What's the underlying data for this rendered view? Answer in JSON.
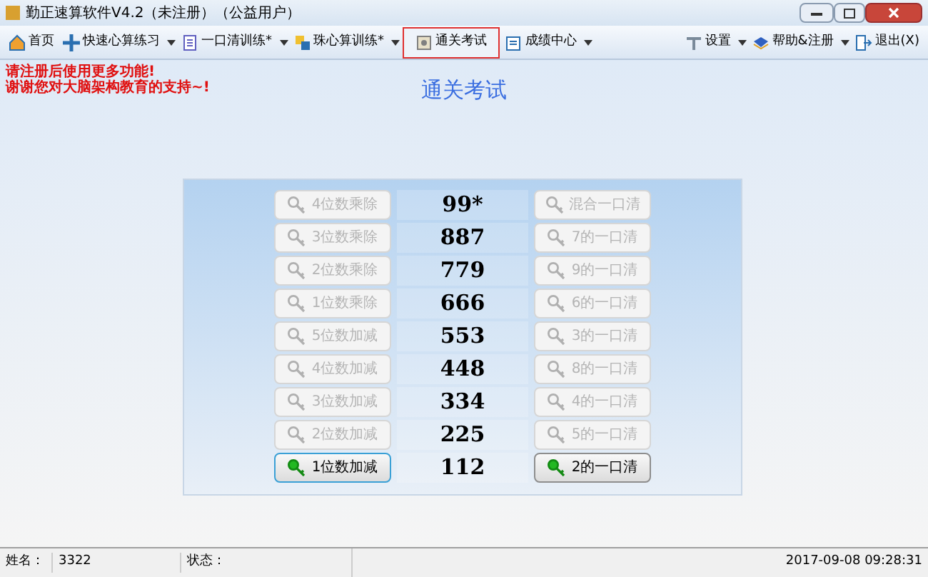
{
  "window": {
    "title": "勤正速算软件V4.2（未注册）（公益用户）"
  },
  "toolbar": {
    "left": [
      {
        "label": "首页",
        "dropdown": false,
        "selected": false
      },
      {
        "label": "快速心算练习",
        "dropdown": true,
        "selected": false
      },
      {
        "label": "一口清训练*",
        "dropdown": true,
        "selected": false
      },
      {
        "label": "珠心算训练*",
        "dropdown": true,
        "selected": false
      },
      {
        "label": "通关考试",
        "dropdown": false,
        "selected": true
      },
      {
        "label": "成绩中心",
        "dropdown": true,
        "selected": false
      }
    ],
    "right": [
      {
        "label": "设置",
        "dropdown": true,
        "selected": false
      },
      {
        "label": "帮助&注册",
        "dropdown": true,
        "selected": false
      },
      {
        "label": "退出(X)",
        "dropdown": false,
        "selected": false
      }
    ]
  },
  "notice": [
    "请注册后使用更多功能!",
    "谢谢您对大脑架构教育的支持~!"
  ],
  "page_title": "通关考试",
  "levels": [
    {
      "left": "4位数乘除",
      "left_disabled": true,
      "number": "99*",
      "right": "混合一口清",
      "right_disabled": true
    },
    {
      "left": "3位数乘除",
      "left_disabled": true,
      "number": "887",
      "right": "7的一口清",
      "right_disabled": true
    },
    {
      "left": "2位数乘除",
      "left_disabled": true,
      "number": "779",
      "right": "9的一口清",
      "right_disabled": true
    },
    {
      "left": "1位数乘除",
      "left_disabled": true,
      "number": "666",
      "right": "6的一口清",
      "right_disabled": true
    },
    {
      "left": "5位数加减",
      "left_disabled": true,
      "number": "553",
      "right": "3的一口清",
      "right_disabled": true
    },
    {
      "left": "4位数加减",
      "left_disabled": true,
      "number": "448",
      "right": "8的一口清",
      "right_disabled": true
    },
    {
      "left": "3位数加减",
      "left_disabled": true,
      "number": "334",
      "right": "4的一口清",
      "right_disabled": true
    },
    {
      "left": "2位数加减",
      "left_disabled": true,
      "number": "225",
      "right": "5的一口清",
      "right_disabled": true
    },
    {
      "left": "1位数加减",
      "left_disabled": false,
      "number": "112",
      "right": "2的一口清",
      "right_disabled": false
    }
  ],
  "status_bar": {
    "name_label": "姓名：",
    "name": "3322",
    "state_label": "状态：",
    "datetime": "2017-09-08 09:28:31"
  }
}
